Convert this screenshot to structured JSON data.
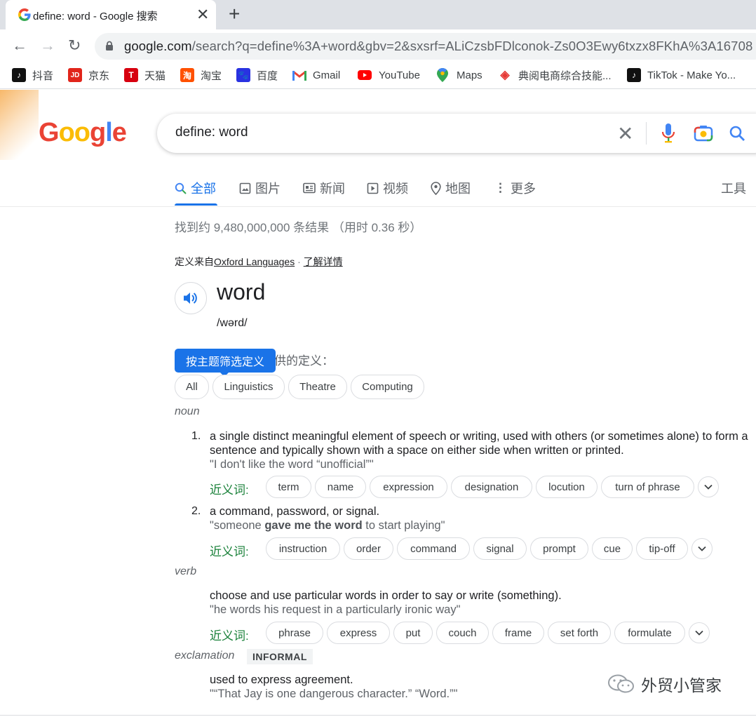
{
  "browser": {
    "tab_title": "define: word - Google 搜索",
    "url_host": "google.com",
    "url_path": "/search?q=define%3A+word&gbv=2&sxsrf=ALiCzsbFDlconok-Zs0O3Ewy6txzx8FKhA%3A16708"
  },
  "bookmarks": [
    {
      "label": "抖音",
      "icon": "tiktok-icon"
    },
    {
      "label": "京东",
      "icon": "jd-icon"
    },
    {
      "label": "天猫",
      "icon": "tmall-icon"
    },
    {
      "label": "淘宝",
      "icon": "taobao-icon"
    },
    {
      "label": "百度",
      "icon": "baidu-icon"
    },
    {
      "label": "Gmail",
      "icon": "gmail-icon"
    },
    {
      "label": "YouTube",
      "icon": "youtube-icon"
    },
    {
      "label": "Maps",
      "icon": "maps-icon"
    },
    {
      "label": "典阅电商综合技能...",
      "icon": "dianyue-icon"
    },
    {
      "label": "TikTok - Make Yo...",
      "icon": "tiktok-icon"
    }
  ],
  "google": {
    "logo_letters": [
      "G",
      "o",
      "o",
      "g",
      "l",
      "e"
    ],
    "query": "define: word"
  },
  "search_tabs": {
    "all": "全部",
    "images": "图片",
    "news": "新闻",
    "videos": "视频",
    "maps": "地图",
    "more": "更多",
    "tools": "工具"
  },
  "result_stats": "找到约 9,480,000,000 条结果 （用时 0.36 秒）",
  "dictionary": {
    "source_prefix": "定义来自",
    "source_name": "Oxford Languages",
    "source_sep": " · ",
    "learn_more": "了解详情",
    "headword": "word",
    "phonetic": "/wərd/",
    "definitions_label": "供的定义：",
    "filter_tooltip": "按主题筛选定义",
    "topic_chips": [
      "All",
      "Linguistics",
      "Theatre",
      "Computing"
    ],
    "synonyms_label": "近义词:",
    "noun": {
      "pos": "noun",
      "senses": [
        {
          "number": "1.",
          "definition": "a single distinct meaningful element of speech or writing, used with others (or sometimes alone) to form a sentence and typically shown with a space on either side when written or printed.",
          "example": "\"I don't like the word “unofficial”\"",
          "synonyms": [
            "term",
            "name",
            "expression",
            "designation",
            "locution",
            "turn of phrase"
          ]
        },
        {
          "number": "2.",
          "definition": "a command, password, or signal.",
          "example_before": "\"someone ",
          "example_bold": "gave me the word",
          "example_after": " to start playing\"",
          "synonyms": [
            "instruction",
            "order",
            "command",
            "signal",
            "prompt",
            "cue",
            "tip-off"
          ]
        }
      ]
    },
    "verb": {
      "pos": "verb",
      "definition": "choose and use particular words in order to say or write (something).",
      "example": "\"he words his request in a particularly ironic way\"",
      "synonyms": [
        "phrase",
        "express",
        "put",
        "couch",
        "frame",
        "set forth",
        "formulate"
      ]
    },
    "exclamation": {
      "pos": "exclamation",
      "register": "INFORMAL",
      "definition": "used to express agreement.",
      "example": "\"“That Jay is one dangerous character.” “Word.”\""
    }
  },
  "watermark": "外贸小管家",
  "colors": {
    "accent_blue": "#1a73e8",
    "synonym_green": "#188038",
    "logo_blue": "#4285f4",
    "logo_red": "#ea4335",
    "logo_yellow": "#fbbc05",
    "logo_green": "#34a853"
  }
}
